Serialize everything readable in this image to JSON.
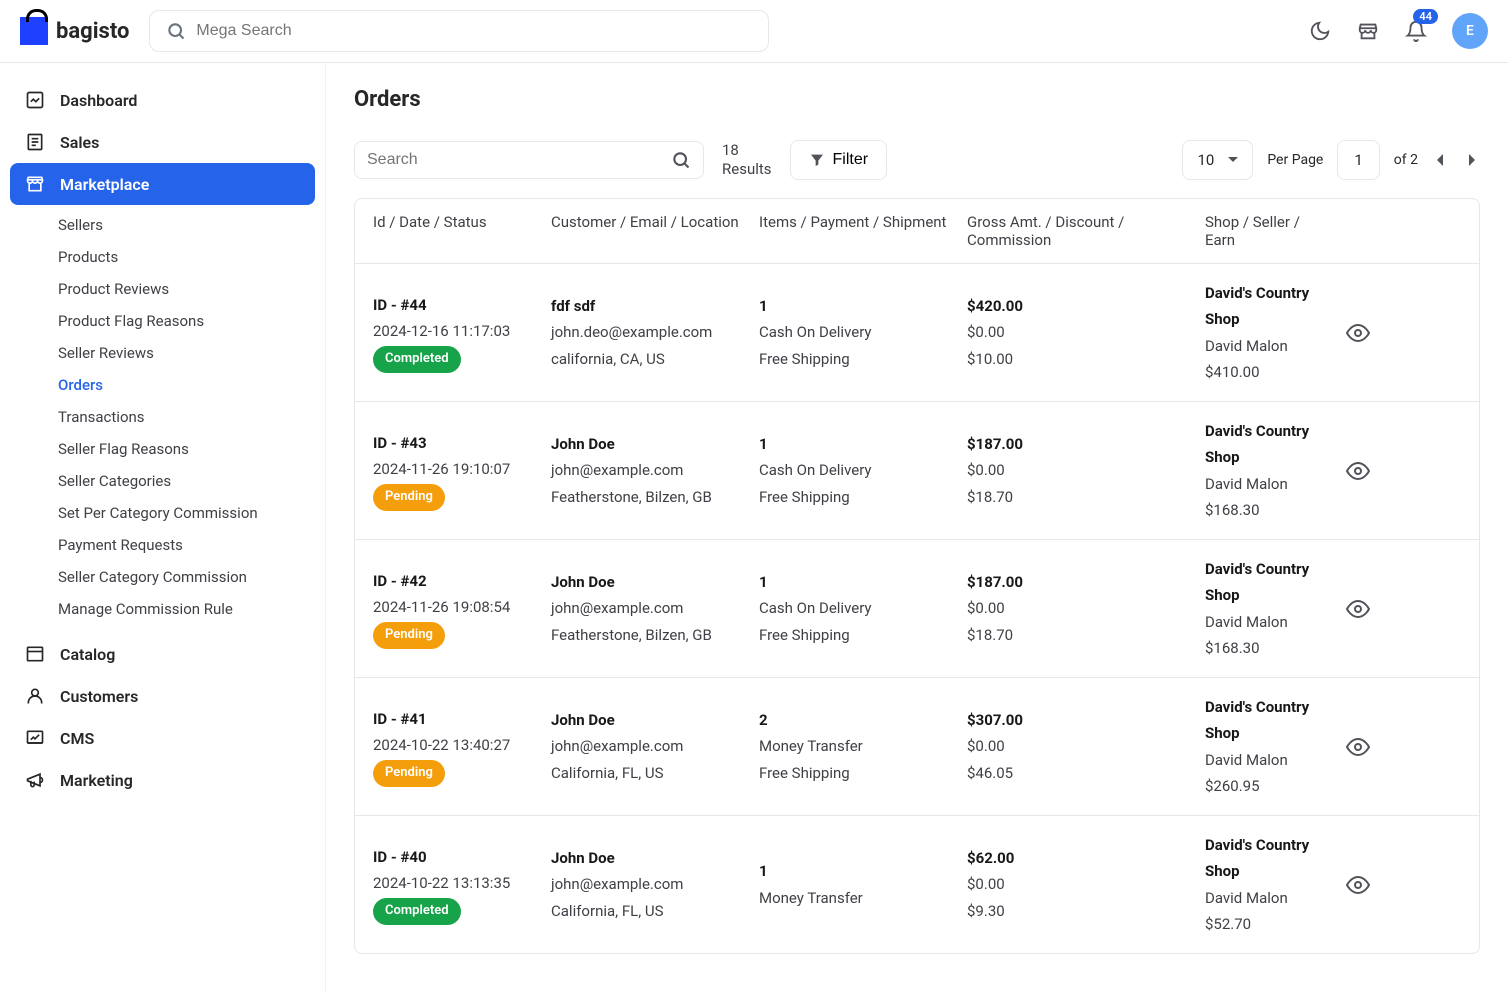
{
  "brand": "bagisto",
  "header": {
    "search_placeholder": "Mega Search",
    "notif_count": "44",
    "avatar_initial": "E"
  },
  "sidebar": {
    "items": [
      {
        "label": "Dashboard"
      },
      {
        "label": "Sales"
      },
      {
        "label": "Marketplace"
      },
      {
        "label": "Catalog"
      },
      {
        "label": "Customers"
      },
      {
        "label": "CMS"
      },
      {
        "label": "Marketing"
      }
    ],
    "marketplace_sub": [
      {
        "label": "Sellers"
      },
      {
        "label": "Products"
      },
      {
        "label": "Product Reviews"
      },
      {
        "label": "Product Flag Reasons"
      },
      {
        "label": "Seller Reviews"
      },
      {
        "label": "Orders"
      },
      {
        "label": "Transactions"
      },
      {
        "label": "Seller Flag Reasons"
      },
      {
        "label": "Seller Categories"
      },
      {
        "label": "Set Per Category Commission"
      },
      {
        "label": "Payment Requests"
      },
      {
        "label": "Seller Category Commission"
      },
      {
        "label": "Manage Commission Rule"
      }
    ]
  },
  "page": {
    "title": "Orders",
    "search_placeholder": "Search",
    "results_count": "18",
    "results_label": "Results",
    "filter_label": "Filter",
    "per_page_value": "10",
    "per_page_label": "Per Page",
    "page_current": "1",
    "page_total_label": "of 2"
  },
  "columns": {
    "c1": "Id / Date / Status",
    "c2": "Customer / Email / Location",
    "c3": "Items / Payment / Shipment",
    "c4": "Gross Amt. / Discount / Commission",
    "c5": "Shop / Seller / Earn"
  },
  "rows": [
    {
      "id": "ID - #44",
      "date": "2024-12-16 11:17:03",
      "status": "Completed",
      "status_class": "completed",
      "customer": "fdf sdf",
      "email": "john.deo@example.com",
      "location": "california, CA, US",
      "items": "1",
      "payment": "Cash On Delivery",
      "shipment": "Free Shipping",
      "gross": "$420.00",
      "discount": "$0.00",
      "commission": "$10.00",
      "shop": "David's Country Shop",
      "seller": "David Malon",
      "earn": "$410.00"
    },
    {
      "id": "ID - #43",
      "date": "2024-11-26 19:10:07",
      "status": "Pending",
      "status_class": "pending",
      "customer": "John Doe",
      "email": "john@example.com",
      "location": "Featherstone, Bilzen, GB",
      "items": "1",
      "payment": "Cash On Delivery",
      "shipment": "Free Shipping",
      "gross": "$187.00",
      "discount": "$0.00",
      "commission": "$18.70",
      "shop": "David's Country Shop",
      "seller": "David Malon",
      "earn": "$168.30"
    },
    {
      "id": "ID - #42",
      "date": "2024-11-26 19:08:54",
      "status": "Pending",
      "status_class": "pending",
      "customer": "John Doe",
      "email": "john@example.com",
      "location": "Featherstone, Bilzen, GB",
      "items": "1",
      "payment": "Cash On Delivery",
      "shipment": "Free Shipping",
      "gross": "$187.00",
      "discount": "$0.00",
      "commission": "$18.70",
      "shop": "David's Country Shop",
      "seller": "David Malon",
      "earn": "$168.30"
    },
    {
      "id": "ID - #41",
      "date": "2024-10-22 13:40:27",
      "status": "Pending",
      "status_class": "pending",
      "customer": "John Doe",
      "email": "john@example.com",
      "location": "California, FL, US",
      "items": "2",
      "payment": "Money Transfer",
      "shipment": "Free Shipping",
      "gross": "$307.00",
      "discount": "$0.00",
      "commission": "$46.05",
      "shop": "David's Country Shop",
      "seller": "David Malon",
      "earn": "$260.95"
    },
    {
      "id": "ID - #40",
      "date": "2024-10-22 13:13:35",
      "status": "Completed",
      "status_class": "completed",
      "customer": "John Doe",
      "email": "john@example.com",
      "location": "California, FL, US",
      "items": "1",
      "payment": "Money Transfer",
      "shipment": "",
      "gross": "$62.00",
      "discount": "$0.00",
      "commission": "$9.30",
      "shop": "David's Country Shop",
      "seller": "David Malon",
      "earn": "$52.70"
    }
  ]
}
